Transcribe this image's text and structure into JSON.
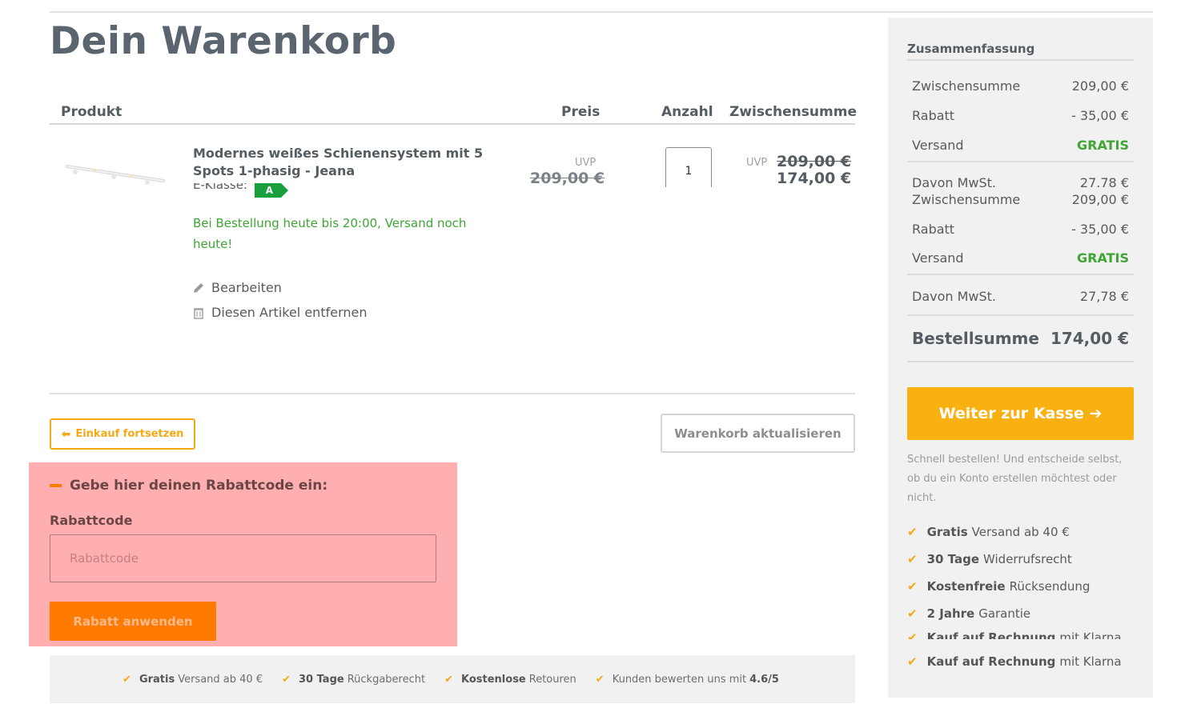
{
  "page_title": "Dein Warenkorb",
  "table_headers": {
    "product": "Produkt",
    "price": "Preis",
    "quantity": "Anzahl",
    "subtotal": "Zwischensumme"
  },
  "item": {
    "name": "Modernes weißes Schienensystem mit 5 Spots 1-phasig - Jeana",
    "energy_label": "E-Klasse:",
    "energy_class": "A",
    "shipping_note": "Bei Bestellung heute bis 20:00, Versand noch heute!",
    "edit": "Bearbeiten",
    "remove": "Diesen Artikel entfernen",
    "uvp_label": "UVP",
    "price_old": "209,00 €",
    "quantity": "1",
    "subtotal_uvp_label": "UVP",
    "subtotal_old": "209,00 €",
    "subtotal_new": "174,00 €"
  },
  "buttons": {
    "continue_shopping": "Einkauf fortsetzen",
    "update_cart": "Warenkorb aktualisieren",
    "checkout": "Weiter zur Kasse"
  },
  "coupon": {
    "toggle": "Gebe hier deinen Rabattcode ein:",
    "label": "Rabattcode",
    "placeholder": "Rabattcode",
    "apply": "Rabatt anwenden"
  },
  "usp_bar": [
    {
      "bold": "Gratis",
      "text": "Versand ab 40 €"
    },
    {
      "bold": "30 Tage",
      "text": "Rückgaberecht"
    },
    {
      "bold": "Kostenlose",
      "text": "Retouren"
    },
    {
      "text": "Kunden bewerten uns mit",
      "bold_after": "4.6/5"
    }
  ],
  "summary": {
    "title": "Zusammenfassung",
    "rows_a": [
      {
        "label": "Zwischensumme",
        "value": "209,00 €"
      },
      {
        "label": "Rabatt",
        "value": "- 35,00 €"
      },
      {
        "label": "Versand",
        "value": "GRATIS"
      }
    ],
    "vat_a": {
      "label": "Davon MwSt.",
      "value": "27.78 €"
    },
    "rows_b": [
      {
        "label": "Zwischensumme",
        "value": "209,00 €"
      },
      {
        "label": "Rabatt",
        "value": "- 35,00 €"
      },
      {
        "label": "Versand",
        "value": "GRATIS"
      }
    ],
    "vat_b": {
      "label": "Davon MwSt.",
      "value": "27,78 €"
    },
    "total_label": "Bestellsumme",
    "total_value": "174,00 €",
    "quick_note": "Schnell bestellen! Und entscheide selbst, ob du ein Konto erstellen möchtest oder nicht.",
    "usps": [
      {
        "bold": "Gratis",
        "text": "Versand ab 40 €"
      },
      {
        "bold": "30 Tage",
        "text": "Widerrufsrecht"
      },
      {
        "bold": "Kostenfreie",
        "text": "Rücksendung"
      },
      {
        "bold": "2 Jahre",
        "text": "Garantie"
      },
      {
        "bold": "Kauf auf Rechnung",
        "text": "mit Klarna"
      },
      {
        "bold": "Kauf auf Rechnung",
        "text": "mit Klarna"
      }
    ]
  },
  "colors": {
    "accent": "#f9b112",
    "coupon_highlight": "#ffafaf",
    "apply_button": "#ff7a00",
    "success": "#3fa535"
  }
}
